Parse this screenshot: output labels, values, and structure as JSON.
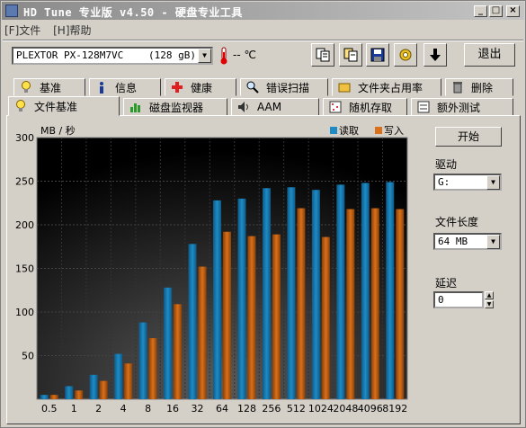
{
  "window": {
    "title": "HD Tune 专业版 v4.50 - 硬盘专业工具"
  },
  "menu": {
    "file": "[F]文件",
    "help": "[H]帮助"
  },
  "drive": {
    "name": "PLEXTOR PX-128M7VC",
    "capacity": "(128 gB)",
    "temp": "-- ℃"
  },
  "toolbar": {
    "exit_label": "退出"
  },
  "tabs_top": [
    "基准",
    "信息",
    "健康",
    "错误扫描",
    "文件夹占用率",
    "删除"
  ],
  "tabs_bottom": [
    "文件基准",
    "磁盘监视器",
    "AAM",
    "随机存取",
    "额外测试"
  ],
  "side": {
    "start_label": "开始",
    "drive_label": "驱动",
    "drive_value": "G:",
    "filelen_label": "文件长度",
    "filelen_value": "64 MB",
    "delay_label": "延迟",
    "delay_value": "0"
  },
  "colors": {
    "read": "#1e8cc4",
    "write": "#d9701a",
    "chart_bg": "#000000"
  },
  "chart_data": {
    "type": "bar",
    "ylabel": "MB / 秒",
    "ylim": [
      0,
      300
    ],
    "yticks": [
      50,
      100,
      150,
      200,
      250,
      300
    ],
    "categories": [
      "0.5",
      "1",
      "2",
      "4",
      "8",
      "16",
      "32",
      "64",
      "128",
      "256",
      "512",
      "1024",
      "2048",
      "4096",
      "8192"
    ],
    "series": [
      {
        "name": "读取",
        "values": [
          5,
          15,
          28,
          52,
          88,
          128,
          178,
          228,
          230,
          242,
          243,
          240,
          246,
          248,
          249
        ]
      },
      {
        "name": "写入",
        "values": [
          5,
          10,
          21,
          41,
          70,
          109,
          152,
          192,
          187,
          189,
          219,
          186,
          218,
          219,
          218
        ]
      }
    ]
  }
}
